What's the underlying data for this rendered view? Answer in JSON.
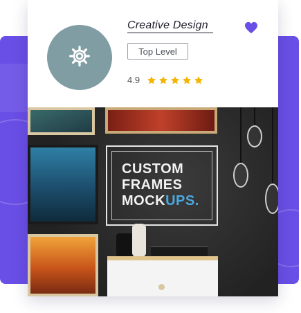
{
  "product": {
    "title": "Creative Design",
    "level_label": "Top Level",
    "rating_value": "4.9",
    "rating_stars": 5
  },
  "mockup": {
    "line1": "CUSTOM",
    "line2": "FRAMES",
    "line3_main": "MOCK",
    "line3_accent": "UPS."
  },
  "colors": {
    "accent": "#6a4fe6",
    "star": "#f5b400",
    "avatar_bg": "#7f9da3"
  },
  "icons": {
    "avatar": "gear-icon",
    "favorite": "heart-icon",
    "rating": "star-icon"
  }
}
